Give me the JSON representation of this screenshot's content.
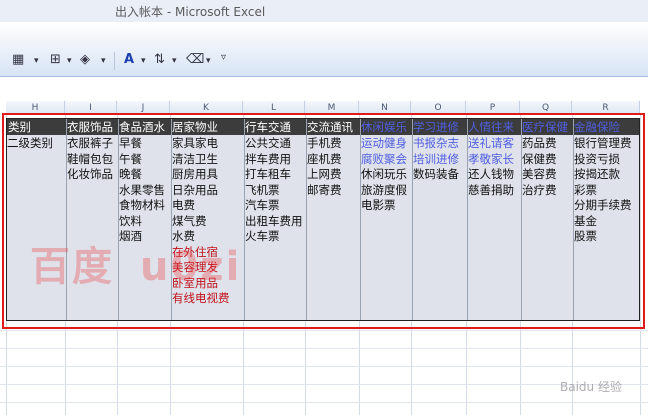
{
  "window": {
    "title": "出入帐本 - Microsoft Excel"
  },
  "toolbar": {
    "icons": [
      "borders-icon",
      "fill-color-icon",
      "font-color-icon",
      "sort-icon",
      "clear-icon",
      "more-icon"
    ]
  },
  "columns": [
    "H",
    "I",
    "J",
    "K",
    "L",
    "M",
    "N",
    "O",
    "P",
    "Q",
    "R"
  ],
  "headers": [
    "类别",
    "衣服饰品",
    "食品酒水",
    "居家物业",
    "行车交通",
    "交流通讯",
    "休闲娱乐",
    "学习进修",
    "人情往来",
    "医疗保健",
    "金融保险"
  ],
  "second_level_label": "二级类别",
  "cells": {
    "I": [
      "衣服裤子",
      "鞋帽包包",
      "化妆饰品"
    ],
    "J": [
      "早餐",
      "午餐",
      "晚餐",
      "水果零售",
      "食物材料",
      "饮料",
      "烟酒"
    ],
    "K": [
      "家具家电",
      "清洁卫生",
      "厨房用具",
      "日杂用品",
      "电费",
      "煤气费",
      "水费",
      "在外住宿",
      "美容理发",
      "卧室用品",
      "有线电视费"
    ],
    "L": [
      "公共交通",
      "拌车费用",
      "打车租车",
      "飞机票",
      "汽车票",
      "出租车费用",
      "火车票"
    ],
    "M": [
      "手机费",
      "座机费",
      "上网费",
      "邮寄费"
    ],
    "N": [
      "运动健身",
      "腐败聚会",
      "休闲玩乐",
      "旅游度假",
      "电影票"
    ],
    "O": [
      "书报杂志",
      "培训进修",
      "数码装备"
    ],
    "P": [
      "送礼请客",
      "孝敬家长",
      "还人钱物",
      "慈善捐助"
    ],
    "Q": [
      "药品费",
      "保健费",
      "美容费",
      "治疗费"
    ],
    "R": [
      "银行管理费",
      "投资亏损",
      "按揭还款",
      "彩票",
      "分期手续费",
      "基金",
      "股票"
    ]
  },
  "watermark": "百度",
  "watermark_tail": "u0zi",
  "logo_text": "Baidu 经验",
  "colors": {
    "accent_red": "#e11a1a",
    "header_dark": "#3c3c3c",
    "link_blue": "#4f5fe0"
  }
}
